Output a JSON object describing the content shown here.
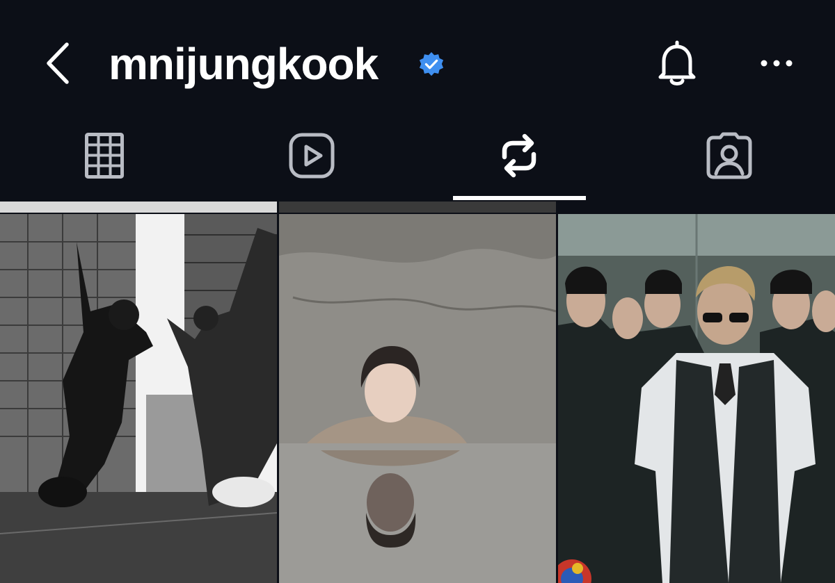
{
  "header": {
    "back_icon": "chevron-left-icon",
    "username": "mnijungkook",
    "verified_icon": "verified-badge-icon",
    "notifications_icon": "bell-icon",
    "more_icon": "more-horizontal-icon"
  },
  "tabs": [
    {
      "name": "posts",
      "icon": "grid-icon"
    },
    {
      "name": "reels",
      "icon": "play-icon"
    },
    {
      "name": "reposts",
      "icon": "repost-icon",
      "active": true
    },
    {
      "name": "tagged",
      "icon": "person-tag-icon"
    }
  ],
  "colors": {
    "background": "#0c0f17",
    "text": "#ffffff",
    "icon_inactive": "#b9bcc4",
    "verified": "#3f8ff0",
    "active_indicator": "#ffffff"
  },
  "posts": [
    {
      "name": "post-street-jump-bw",
      "tone": "monochrome"
    },
    {
      "name": "post-water-reflection",
      "tone": "grey"
    },
    {
      "name": "post-suits-elevator",
      "tone": "teal"
    }
  ]
}
